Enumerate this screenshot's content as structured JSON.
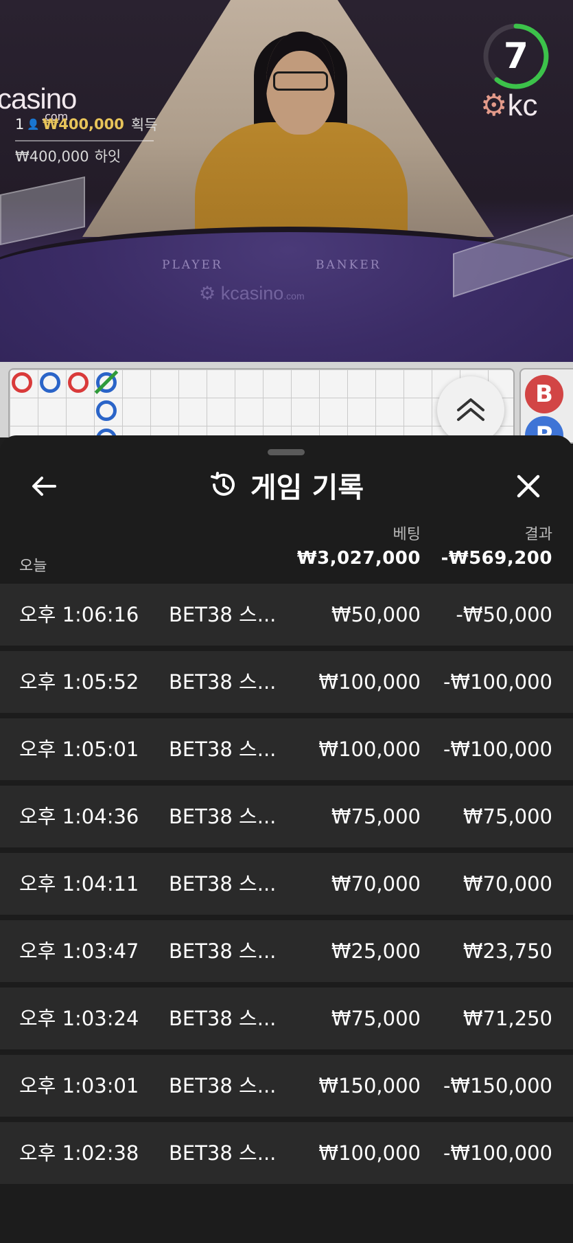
{
  "video": {
    "timer": "7",
    "brand_left": "casino",
    "brand_left_sub": ".com",
    "brand_right": "kc",
    "table_player_label": "PLAYER",
    "table_banker_label": "BANKER",
    "table_logo": "kcasino",
    "table_logo_sub": ".com",
    "win_rank": "1",
    "win_amount": "₩400,000",
    "win_suffix": "획득",
    "hit_amount": "₩400,000",
    "hit_suffix": "하잇"
  },
  "roadmap": {
    "side_b": "B",
    "side_p": "P",
    "colors": {
      "banker": "#d93a3a",
      "player": "#2a64c8",
      "tie": "#2f9a3a"
    }
  },
  "sheet": {
    "title": "게임 기록",
    "icons": {
      "back": "arrow-left-icon",
      "history": "history-icon",
      "close": "close-icon",
      "expand": "chevron-up-double-icon"
    },
    "col_bet": "베팅",
    "col_result": "결과",
    "today_label": "오늘",
    "total_bet": "₩3,027,000",
    "total_result": "-₩569,200",
    "rows": [
      {
        "time": "오후 1:06:16",
        "game": "BET38 스...",
        "bet": "₩50,000",
        "result": "-₩50,000"
      },
      {
        "time": "오후 1:05:52",
        "game": "BET38 스...",
        "bet": "₩100,000",
        "result": "-₩100,000"
      },
      {
        "time": "오후 1:05:01",
        "game": "BET38 스...",
        "bet": "₩100,000",
        "result": "-₩100,000"
      },
      {
        "time": "오후 1:04:36",
        "game": "BET38 스...",
        "bet": "₩75,000",
        "result": "₩75,000"
      },
      {
        "time": "오후 1:04:11",
        "game": "BET38 스...",
        "bet": "₩70,000",
        "result": "₩70,000"
      },
      {
        "time": "오후 1:03:47",
        "game": "BET38 스...",
        "bet": "₩25,000",
        "result": "₩23,750"
      },
      {
        "time": "오후 1:03:24",
        "game": "BET38 스...",
        "bet": "₩75,000",
        "result": "₩71,250"
      },
      {
        "time": "오후 1:03:01",
        "game": "BET38 스...",
        "bet": "₩150,000",
        "result": "-₩150,000"
      },
      {
        "time": "오후 1:02:38",
        "game": "BET38 스...",
        "bet": "₩100,000",
        "result": "-₩100,000"
      }
    ]
  }
}
